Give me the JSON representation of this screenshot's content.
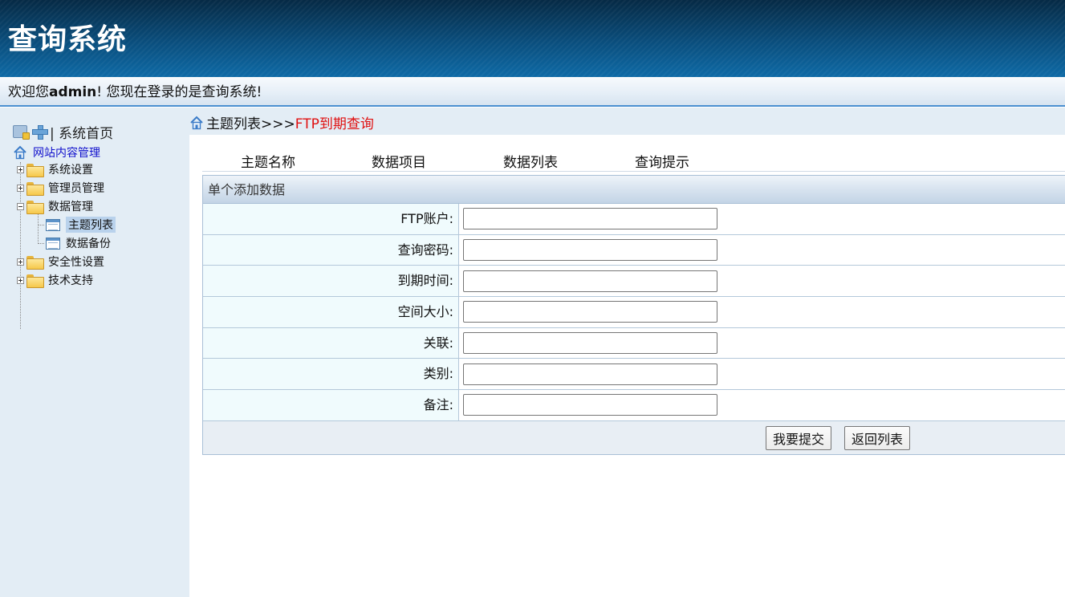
{
  "header": {
    "title": "查询系统"
  },
  "welcome": {
    "prefix": "欢迎您",
    "user": "admin",
    "suffix": "! 您现在登录的是查询系统!"
  },
  "sidebar": {
    "top_label": "| 系统首页",
    "root_label": "网站内容管理",
    "items": [
      {
        "label": "系统设置",
        "expanded": false
      },
      {
        "label": "管理员管理",
        "expanded": false
      },
      {
        "label": "数据管理",
        "expanded": true,
        "children": [
          {
            "label": "主题列表",
            "selected": true
          },
          {
            "label": "数据备份",
            "selected": false
          }
        ]
      },
      {
        "label": "安全性设置",
        "expanded": false
      },
      {
        "label": "技术支持",
        "expanded": false
      }
    ]
  },
  "breadcrumb": {
    "path": "主题列表>>>",
    "current": "FTP到期查询"
  },
  "tabs": [
    "主题名称",
    "数据项目",
    "数据列表",
    "查询提示"
  ],
  "form": {
    "title": "单个添加数据",
    "fields": [
      {
        "label": "FTP账户:",
        "value": ""
      },
      {
        "label": "查询密码:",
        "value": ""
      },
      {
        "label": "到期时间:",
        "value": ""
      },
      {
        "label": "空间大小:",
        "value": ""
      },
      {
        "label": "关联:",
        "value": ""
      },
      {
        "label": "类别:",
        "value": ""
      },
      {
        "label": "备注:",
        "value": ""
      }
    ],
    "submit_label": "我要提交",
    "back_label": "返回列表"
  },
  "colors": {
    "header_dark": "#062a45",
    "breadcrumb_current": "#e01010",
    "tree_root_link": "#1010cc",
    "sidebar_bg": "#e3edf5"
  }
}
